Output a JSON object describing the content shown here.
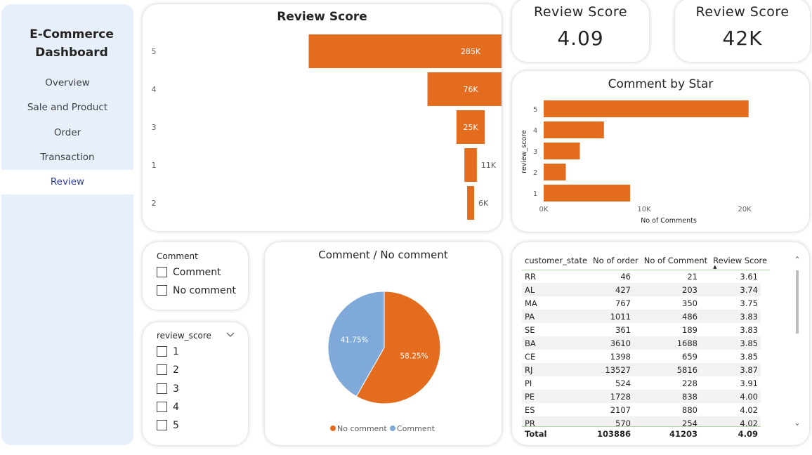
{
  "sidebar": {
    "title_line1": "E-Commerce",
    "title_line2": "Dashboard",
    "items": [
      {
        "label": "Overview"
      },
      {
        "label": "Sale and Product"
      },
      {
        "label": "Order"
      },
      {
        "label": "Transaction"
      },
      {
        "label": "Review"
      }
    ],
    "active": "Review"
  },
  "kpis": [
    {
      "title": "Review Score",
      "value": "4.09"
    },
    {
      "title": "Review Score",
      "value": "42K"
    }
  ],
  "funnel": {
    "title": "Review Score",
    "color": "#e46c1e",
    "chart_data": {
      "type": "bar",
      "categories": [
        "5",
        "4",
        "3",
        "1",
        "2"
      ],
      "values": [
        285000,
        76000,
        25000,
        11000,
        6000
      ],
      "labels": [
        "285K",
        "76K",
        "25K",
        "11K",
        "6K"
      ]
    }
  },
  "comment_by_star": {
    "title": "Comment by Star",
    "color": "#e46c1e",
    "chart_data": {
      "type": "bar",
      "orientation": "horizontal",
      "categories": [
        "5",
        "4",
        "3",
        "2",
        "1"
      ],
      "values": [
        20400,
        6000,
        3600,
        2200,
        8600
      ],
      "xlabel": "No of Comments",
      "ylabel": "review_score",
      "xlim": [
        0,
        22000
      ],
      "xticks": [
        "0K",
        "10K",
        "20K"
      ]
    }
  },
  "comment_slicer": {
    "title": "Comment",
    "options": [
      "Comment",
      "No comment"
    ]
  },
  "score_slicer": {
    "title": "review_score",
    "options": [
      "1",
      "2",
      "3",
      "4",
      "5"
    ]
  },
  "pie": {
    "title": "Comment / No comment",
    "chart_data": {
      "type": "pie",
      "slices": [
        {
          "name": "No comment",
          "value": 58.25,
          "label": "58.25%",
          "color": "#e46c1e"
        },
        {
          "name": "Comment",
          "value": 41.75,
          "label": "41.75%",
          "color": "#7ea9d8"
        }
      ]
    }
  },
  "table": {
    "columns": [
      "customer_state",
      "No of order",
      "No of Comment",
      "Review Score"
    ],
    "rows": [
      [
        "RR",
        "46",
        "21",
        "3.61"
      ],
      [
        "AL",
        "427",
        "203",
        "3.74"
      ],
      [
        "MA",
        "767",
        "350",
        "3.75"
      ],
      [
        "PA",
        "1011",
        "486",
        "3.83"
      ],
      [
        "SE",
        "361",
        "189",
        "3.83"
      ],
      [
        "BA",
        "3610",
        "1688",
        "3.85"
      ],
      [
        "CE",
        "1398",
        "659",
        "3.85"
      ],
      [
        "RJ",
        "13527",
        "5816",
        "3.87"
      ],
      [
        "PI",
        "524",
        "228",
        "3.91"
      ],
      [
        "PE",
        "1728",
        "838",
        "4.00"
      ],
      [
        "ES",
        "2107",
        "880",
        "4.02"
      ],
      [
        "PR",
        "570",
        "254",
        "4.02"
      ]
    ],
    "total": [
      "Total",
      "103886",
      "41203",
      "4.09"
    ]
  }
}
